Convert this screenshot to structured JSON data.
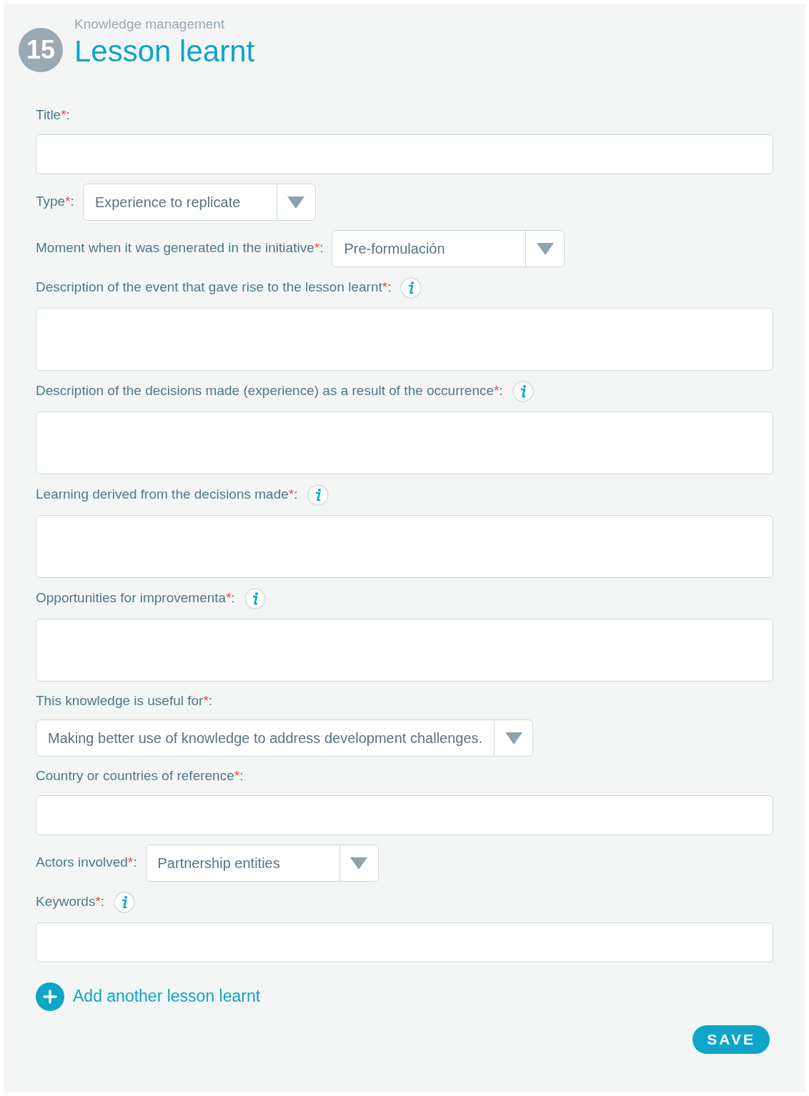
{
  "header": {
    "step": "15",
    "section": "Knowledge management",
    "title": "Lesson learnt"
  },
  "fields": [
    {
      "kind": "input",
      "label": "Title",
      "required_mark": "*",
      "colon": ":",
      "info": false
    },
    {
      "kind": "select",
      "label": "Type",
      "required_mark": "*",
      "colon": ":",
      "info": false,
      "inline": true,
      "value": "Experience to replicate"
    },
    {
      "kind": "select",
      "label": "Moment when it was generated in the initiative",
      "required_mark": "*",
      "colon": ":",
      "info": false,
      "inline": true,
      "value": "Pre-formulación"
    },
    {
      "kind": "textarea",
      "label": "Description of the event that gave rise to the lesson learnt",
      "required_mark": "*",
      "colon": ":",
      "info": true
    },
    {
      "kind": "textarea",
      "label": "Description of the decisions made (experience) as a result of the occurrence",
      "required_mark": "*",
      "colon": ":",
      "info": true
    },
    {
      "kind": "textarea",
      "label": "Learning derived from the decisions made",
      "required_mark": "*",
      "colon": ":",
      "info": true
    },
    {
      "kind": "textarea",
      "label": "Opportunities for improvementa",
      "required_mark": "*",
      "colon": ":",
      "info": true
    },
    {
      "kind": "select",
      "label": "This knowledge is useful for",
      "required_mark": "*",
      "colon": ":",
      "info": false,
      "inline": false,
      "value": "Making better use of knowledge to address development challenges."
    },
    {
      "kind": "input",
      "label": "Country or countries of reference",
      "required_mark": "*",
      "colon": ":",
      "info": false
    },
    {
      "kind": "select",
      "label": "Actors involved",
      "required_mark": "*",
      "colon": ":",
      "info": false,
      "inline": true,
      "value": "Partnership entities"
    },
    {
      "kind": "input",
      "label": "Keywords",
      "required_mark": "*",
      "colon": ":",
      "info": true
    }
  ],
  "add_link": "Add another lesson learnt",
  "save_button": "SAVE"
}
